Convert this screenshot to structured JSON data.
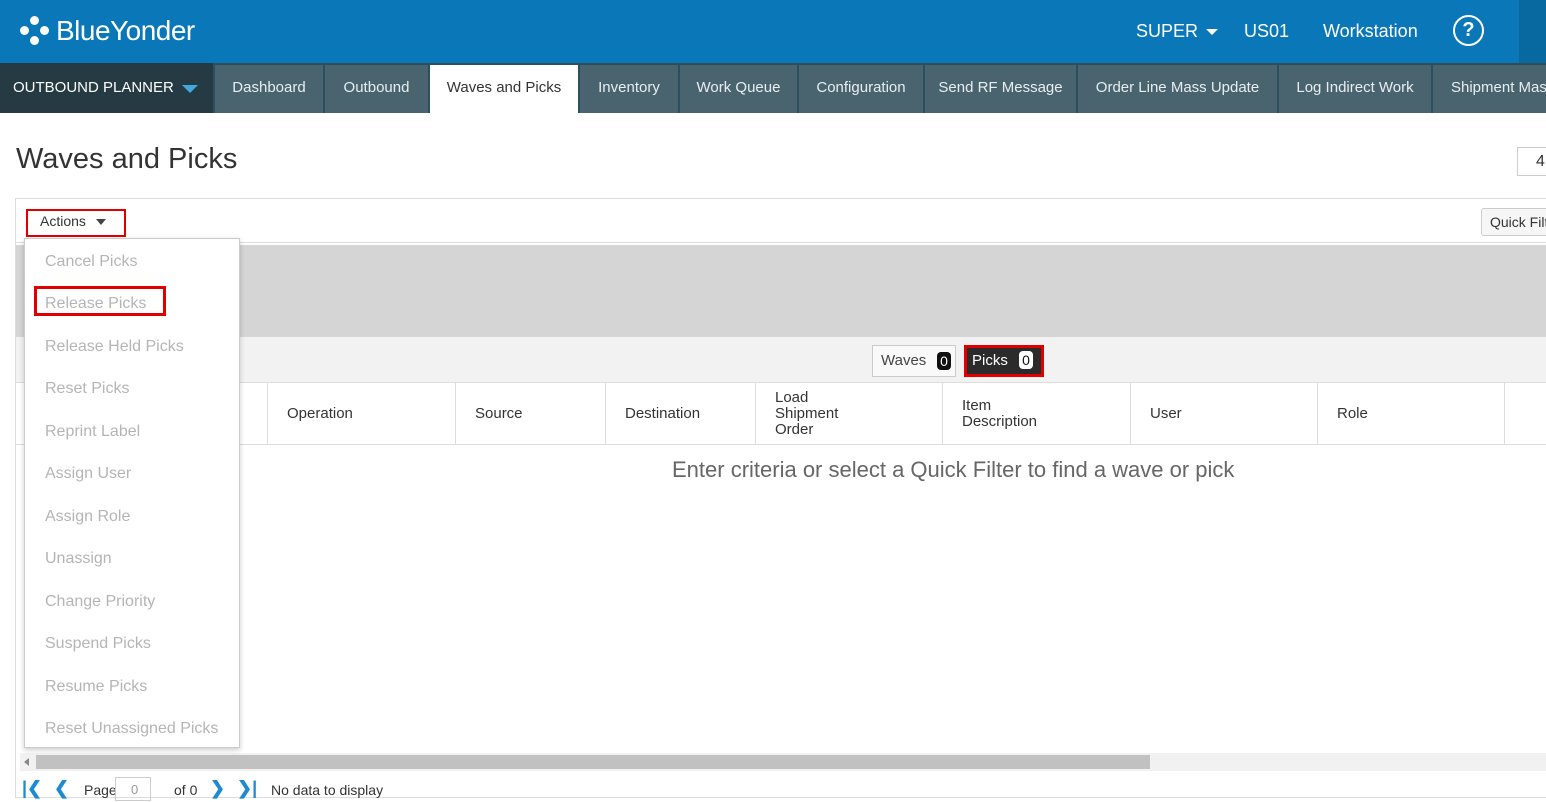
{
  "topbar": {
    "brand": "BlueYonder",
    "user": "SUPER",
    "site": "US01",
    "workstation": "Workstation",
    "help_icon": "?"
  },
  "nav": {
    "app": "OUTBOUND PLANNER",
    "tabs": [
      {
        "label": "Dashboard"
      },
      {
        "label": "Outbound"
      },
      {
        "label": "Waves and Picks",
        "active": true
      },
      {
        "label": "Inventory"
      },
      {
        "label": "Work Queue"
      },
      {
        "label": "Configuration"
      },
      {
        "label": "Send RF Message"
      },
      {
        "label": "Order Line Mass Update"
      },
      {
        "label": "Log Indirect Work"
      },
      {
        "label": "Shipment Mas"
      }
    ]
  },
  "page": {
    "title": "Waves and Picks",
    "top_right_value": "4"
  },
  "toolbar": {
    "actions_label": "Actions",
    "quick_filter_label": "Quick Filt"
  },
  "actions_menu": {
    "items": [
      "Cancel Picks",
      "Release Picks",
      "Release Held Picks",
      "Reset Picks",
      "Reprint Label",
      "Assign User",
      "Assign Role",
      "Unassign",
      "Change Priority",
      "Suspend Picks",
      "Resume Picks",
      "Reset Unassigned Picks"
    ],
    "highlighted": "Release Picks"
  },
  "toggle": {
    "waves_label": "Waves",
    "waves_count": "0",
    "picks_label": "Picks",
    "picks_count": "0",
    "selected": "Picks"
  },
  "grid": {
    "columns": [
      "Operation",
      "Source",
      "Destination",
      "Load\nShipment\nOrder",
      "Item\nDescription",
      "User",
      "Role"
    ],
    "empty_message": "Enter criteria or select a Quick Filter to find a wave or pick"
  },
  "pager": {
    "page_label": "Page",
    "page_value": "0",
    "of_label": "of 0",
    "status": "No data to display"
  },
  "colors": {
    "topbar": "#0a78b8",
    "navbar": "#2d4e5c",
    "highlight": "#e00000",
    "accent": "#1e8ad2"
  }
}
